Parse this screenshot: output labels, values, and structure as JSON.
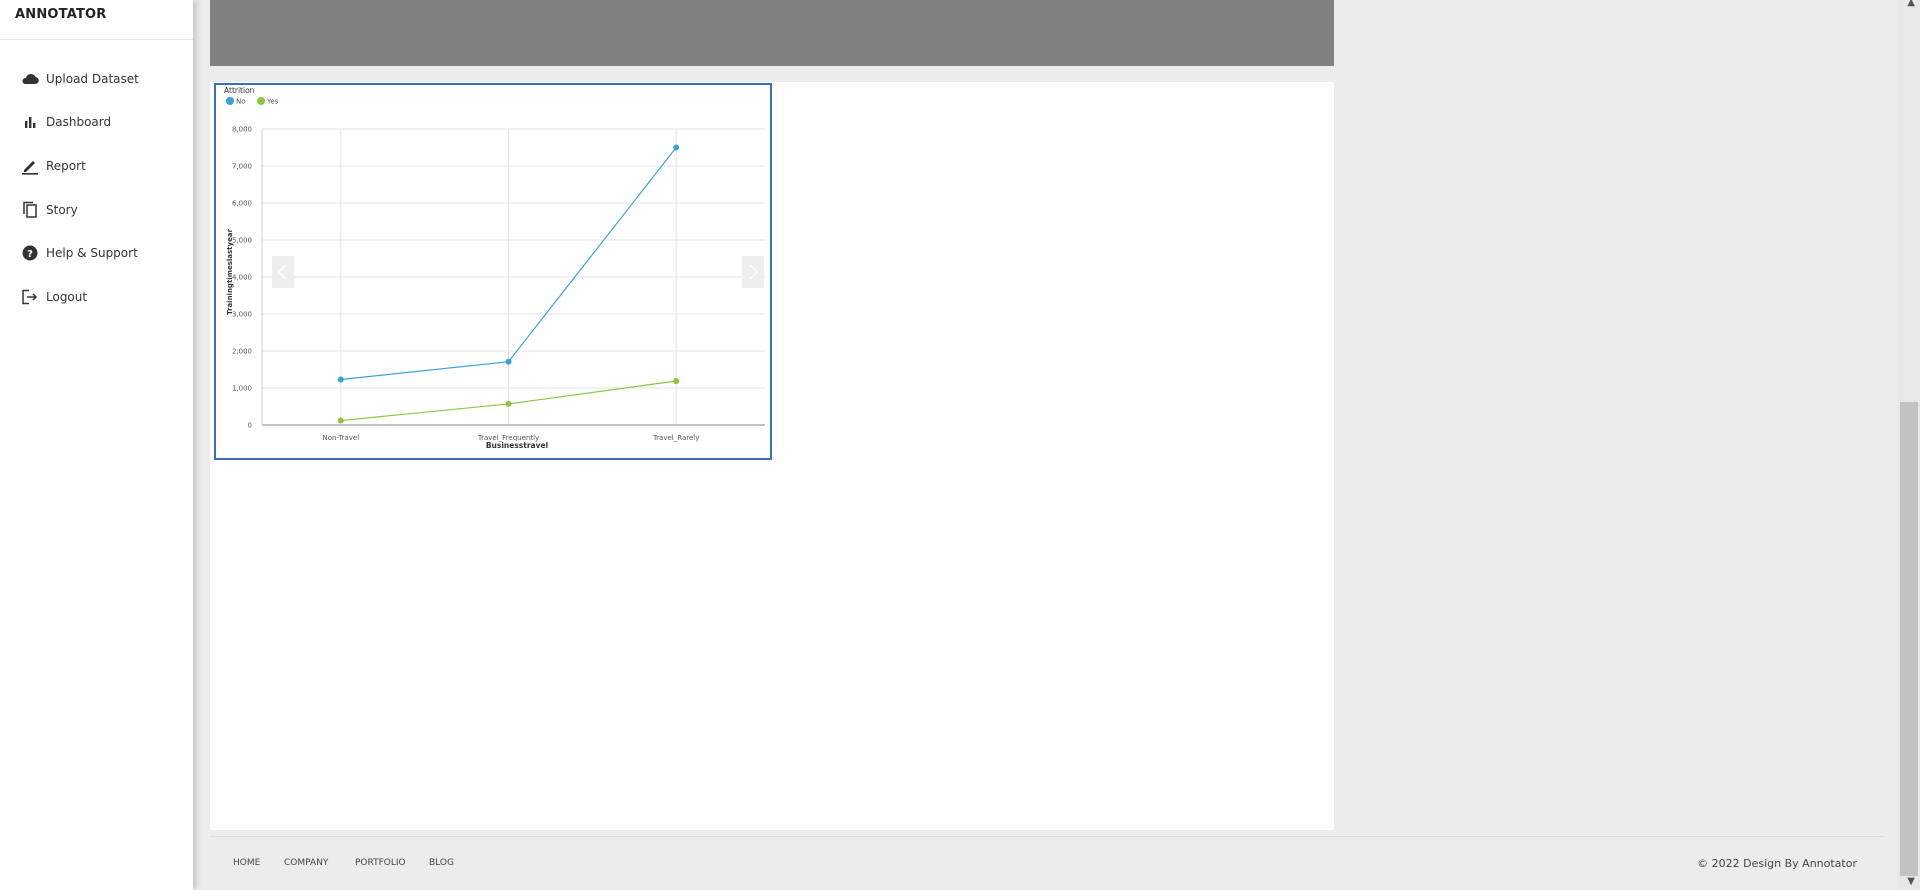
{
  "app": {
    "brand": "ANNOTATOR"
  },
  "sidebar": {
    "items": [
      {
        "label": "Upload Dataset",
        "icon": "cloud-icon"
      },
      {
        "label": "Dashboard",
        "icon": "bar-chart-icon"
      },
      {
        "label": "Report",
        "icon": "pencil-icon"
      },
      {
        "label": "Story",
        "icon": "copy-icon"
      },
      {
        "label": "Help & Support",
        "icon": "question-circle-icon"
      },
      {
        "label": "Logout",
        "icon": "logout-icon"
      }
    ]
  },
  "footer": {
    "links": [
      "HOME",
      "COMPANY",
      "PORTFOLIO",
      "BLOG"
    ],
    "copyright": "© 2022 Design By Annotator"
  },
  "colors": {
    "series_no": "#3aa3dc",
    "series_yes": "#8ec63f",
    "frame": "#3b6fc4",
    "header_band": "#808080"
  },
  "chart_data": {
    "type": "line",
    "legend_title": "Attrition",
    "legend_position": "top-left",
    "categories": [
      "Non-Travel",
      "Travel_Frequently",
      "Travel_Rarely"
    ],
    "series": [
      {
        "name": "No",
        "values": [
          1230,
          1710,
          7500
        ]
      },
      {
        "name": "Yes",
        "values": [
          120,
          570,
          1190
        ]
      }
    ],
    "xlabel": "Businesstravel",
    "ylabel": "Trainingtimeslastyear",
    "ylim": [
      0,
      8000
    ],
    "yticks": [
      "0",
      "1,000",
      "2,000",
      "3,000",
      "4,000",
      "5,000",
      "6,000",
      "7,000",
      "8,000"
    ],
    "grid": true
  }
}
